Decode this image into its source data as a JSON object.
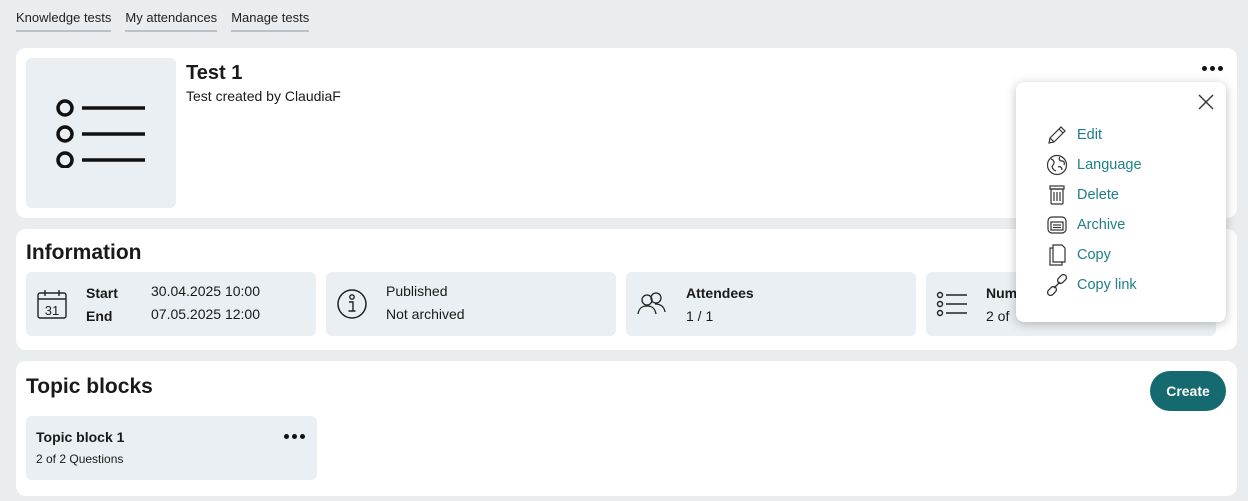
{
  "nav": [
    {
      "label": "Knowledge tests"
    },
    {
      "label": "My attendances"
    },
    {
      "label": "Manage tests"
    }
  ],
  "test": {
    "title": "Test 1",
    "subtitle": "Test created by ClaudiaF"
  },
  "information": {
    "heading": "Information",
    "start_label": "Start",
    "start_value": "30.04.2025 10:00",
    "end_label": "End",
    "end_value": "07.05.2025 12:00",
    "calendar_day": "31",
    "status_published": "Published",
    "status_archived": "Not archived",
    "attendees_label": "Attendees",
    "attendees_value": "1 / 1",
    "number_label": "Num",
    "number_value": "2 of"
  },
  "topics": {
    "heading": "Topic blocks",
    "create_label": "Create",
    "blocks": [
      {
        "title": "Topic block 1",
        "subtitle": "2 of 2 Questions"
      }
    ]
  },
  "menu": {
    "items": [
      {
        "label": "Edit",
        "icon": "pencil-icon"
      },
      {
        "label": "Language",
        "icon": "globe-icon"
      },
      {
        "label": "Delete",
        "icon": "trash-icon"
      },
      {
        "label": "Archive",
        "icon": "archive-icon"
      },
      {
        "label": "Copy",
        "icon": "copy-icon"
      },
      {
        "label": "Copy link",
        "icon": "link-icon"
      }
    ]
  },
  "colors": {
    "accent": "#156a70",
    "link": "#1f7e88",
    "page_bg": "#e9edf0",
    "tile_bg": "#e9eff2"
  }
}
